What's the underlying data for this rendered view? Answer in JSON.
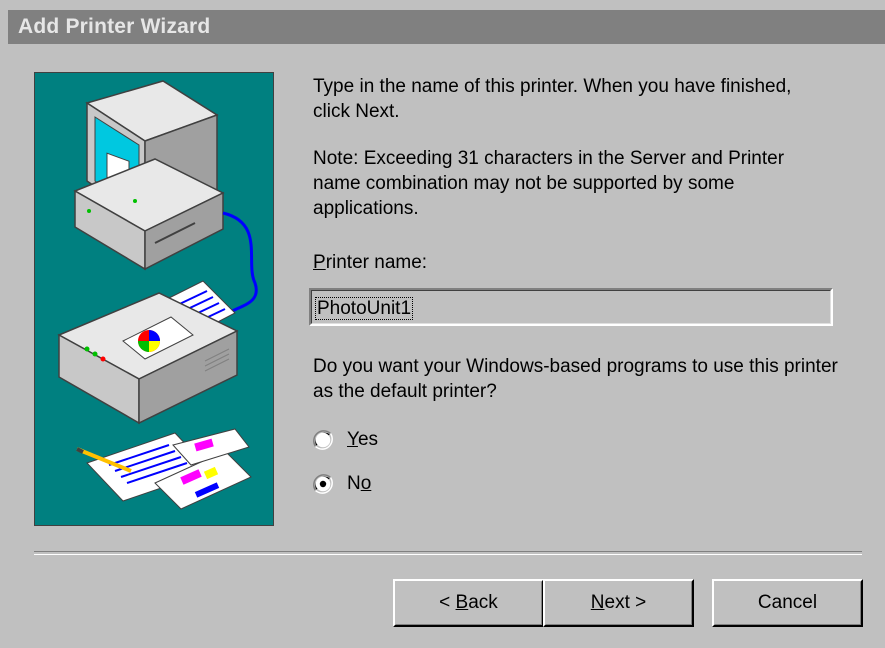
{
  "window": {
    "title": "Add Printer Wizard"
  },
  "instructions": {
    "para1": "Type in the name of this printer.  When you have finished, click Next.",
    "para2": "Note:  Exceeding 31 characters in the Server and Printer name combination may not be supported by some applications."
  },
  "printer_name": {
    "label_underlined": "P",
    "label_rest": "rinter name:",
    "value": "PhotoUnit1"
  },
  "default_printer": {
    "question": "Do you want your Windows-based programs to use this printer as the default printer?",
    "options": [
      {
        "label_underlined": "Y",
        "label_rest": "es",
        "selected": false
      },
      {
        "label_prefix": "N",
        "label_underlined": "o",
        "selected": true
      }
    ]
  },
  "buttons": {
    "back_prefix": "< ",
    "back_underlined": "B",
    "back_rest": "ack",
    "next_underlined": "N",
    "next_rest": "ext >",
    "cancel": "Cancel"
  },
  "colors": {
    "face": "#c0c0c0",
    "titlebar_inactive": "#808080",
    "illustration_bg": "#008080"
  },
  "icons": {
    "illustration": "computer-printer-illustration"
  }
}
